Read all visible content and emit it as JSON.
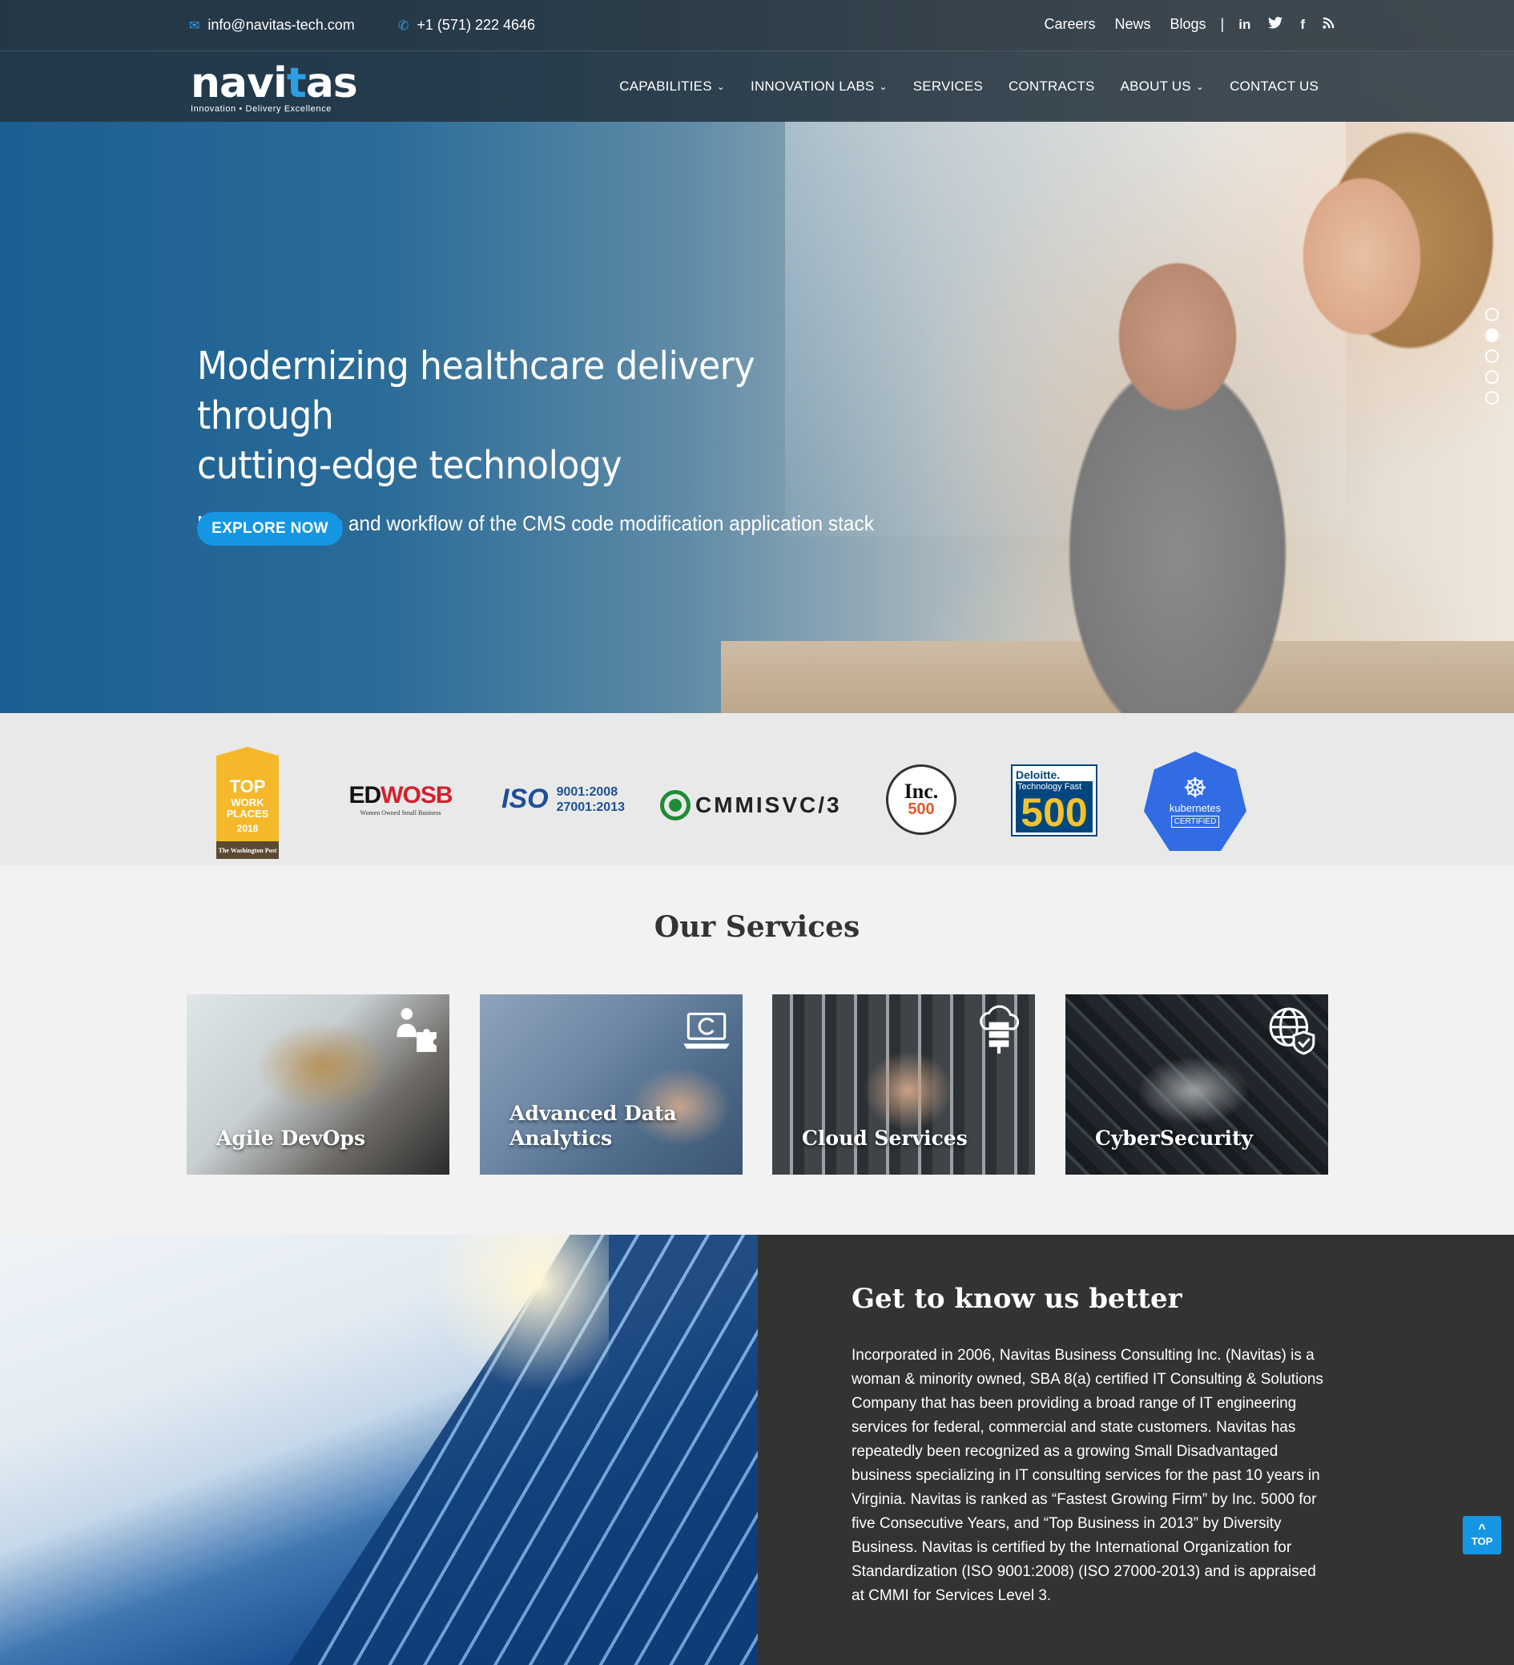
{
  "topbar": {
    "email": "info@navitas-tech.com",
    "phone": "+1 (571) 222 4646",
    "links": [
      "Careers",
      "News",
      "Blogs"
    ],
    "separator": "|",
    "social": [
      "linkedin-icon",
      "twitter-icon",
      "facebook-icon",
      "rss-icon"
    ],
    "social_glyphs": [
      "in",
      "🐦",
      "f",
      "⟟"
    ]
  },
  "brand": {
    "name_pre": "navi",
    "name_t": "t",
    "name_post": "as",
    "tagline": "Innovation • Delivery Excellence"
  },
  "nav": {
    "items": [
      {
        "label": "CAPABILITIES",
        "dropdown": true
      },
      {
        "label": "INNOVATION LABS",
        "dropdown": true
      },
      {
        "label": "SERVICES",
        "dropdown": false
      },
      {
        "label": "CONTRACTS",
        "dropdown": false
      },
      {
        "label": "ABOUT US",
        "dropdown": true
      },
      {
        "label": "CONTACT US",
        "dropdown": false
      }
    ]
  },
  "hero": {
    "title_line1": "Modernizing healthcare delivery through",
    "title_line2": "cutting-edge technology",
    "subtitle": "Manage lifecycle and workflow of the CMS code modification application stack",
    "cta": "EXPLORE NOW",
    "slide_count": 5,
    "active_slide": 2
  },
  "awards": {
    "top_work": {
      "l1": "TOP",
      "l2": "WORK PLACES",
      "l3": "2018",
      "foot": "The Washington Post"
    },
    "edwosb": {
      "ed": "ED",
      "wosb": "WOSB",
      "sub": "Women Owned Small Business"
    },
    "iso": {
      "mark": "ISO",
      "line1": "9001:2008",
      "line2": "27001:2013"
    },
    "cmmi": {
      "text": "CMMISVC/3"
    },
    "inc": {
      "inc": "Inc.",
      "five": "500"
    },
    "deloitte": {
      "d1": "Deloitte.",
      "d2": "Technology Fast",
      "d3": "500"
    },
    "k8s": {
      "wheel": "☸",
      "name": "kubernetes",
      "cert": "CERTIFIED"
    }
  },
  "services": {
    "title": "Our Services",
    "cards": [
      {
        "line1": "Agile DevOps",
        "line2": ""
      },
      {
        "line1": "Advanced Data",
        "line2": "Analytics"
      },
      {
        "line1": "Cloud Services",
        "line2": ""
      },
      {
        "line1": "CyberSecurity",
        "line2": ""
      }
    ]
  },
  "about": {
    "title": "Get to know us better",
    "body": "Incorporated in 2006, Navitas Business Consulting Inc. (Navitas) is a woman & minority owned, SBA 8(a) certified IT Consulting & Solutions Company that has been providing a broad range of IT engineering services for federal, commercial and state customers. Navitas has repeatedly been recognized as a growing Small Disadvantaged business specializing in IT consulting services for the past 10 years in Virginia. Navitas is ranked as “Fastest Growing Firm” by Inc. 5000 for five Consecutive Years, and “Top Business in 2013” by Diversity Business. Navitas is certified by the International Organization for Standardization (ISO 9001:2008) (ISO 27000-2013) and is appraised at CMMI for Services Level 3."
  },
  "back_to_top": {
    "arrow": "^",
    "label": "TOP"
  },
  "colors": {
    "accent": "#1596e2",
    "dark_panel": "#333333",
    "brand_blue": "#2a9fe4"
  }
}
